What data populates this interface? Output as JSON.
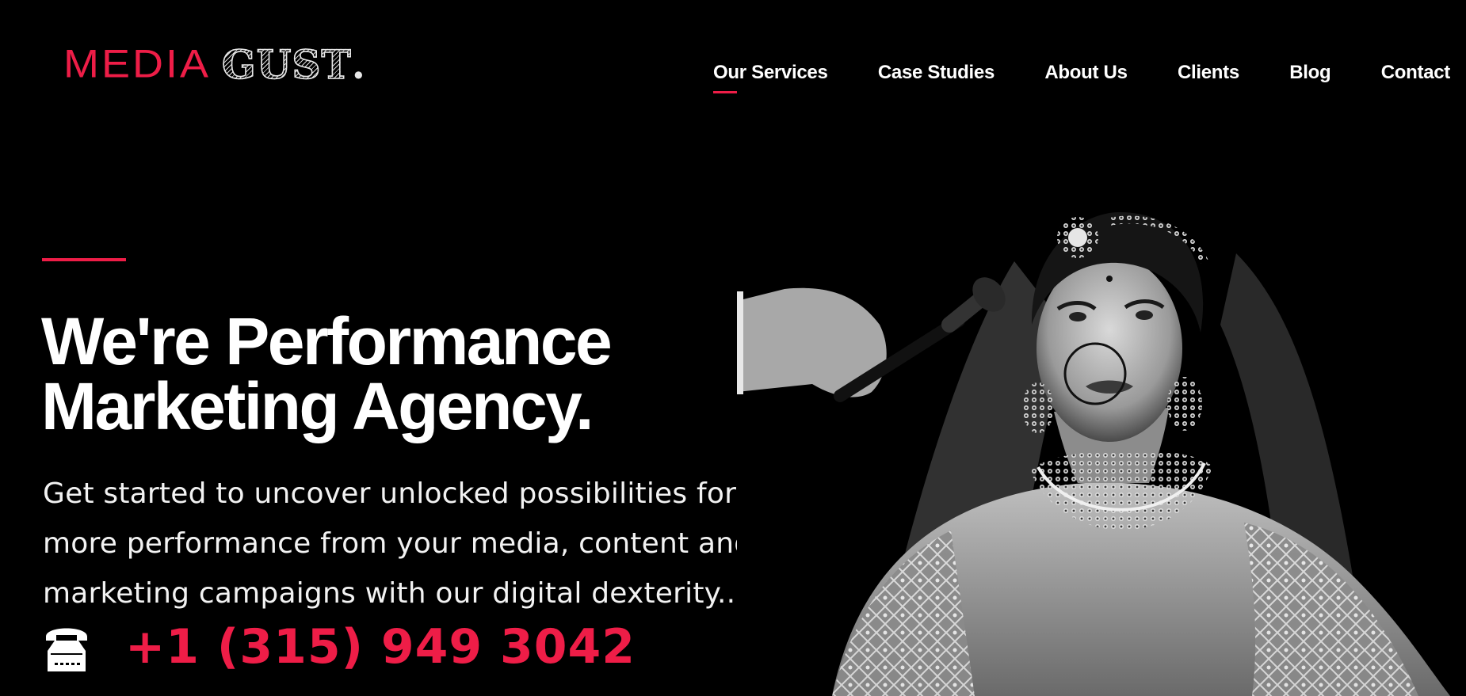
{
  "header": {
    "logo": {
      "part1": "MEDIA",
      "part2": "GUST",
      "dot": ".",
      "accent_color": "#ee1d47"
    },
    "nav": {
      "items": [
        {
          "label": "Our Services",
          "active": true
        },
        {
          "label": "Case Studies",
          "active": false
        },
        {
          "label": "About Us",
          "active": false
        },
        {
          "label": "Clients",
          "active": false
        },
        {
          "label": "Blog",
          "active": false
        },
        {
          "label": "Contact",
          "active": false
        }
      ]
    }
  },
  "hero": {
    "headline_line1": "We're Performance",
    "headline_line2": "Marketing Agency.",
    "subtext_line1": "Get started to uncover unlocked possibilities for",
    "subtext_line2": "more performance from your media, content and",
    "subtext_line3": "marketing campaigns with our digital dexterity...",
    "phone_icon": "telephone-icon",
    "phone_number": "+1 (315) 949 3042",
    "image_subject": "black-and-white photo of a bride in jewelry having makeup applied with a brush"
  },
  "colors": {
    "background": "#000000",
    "accent": "#ee1d47",
    "text": "#ffffff"
  }
}
